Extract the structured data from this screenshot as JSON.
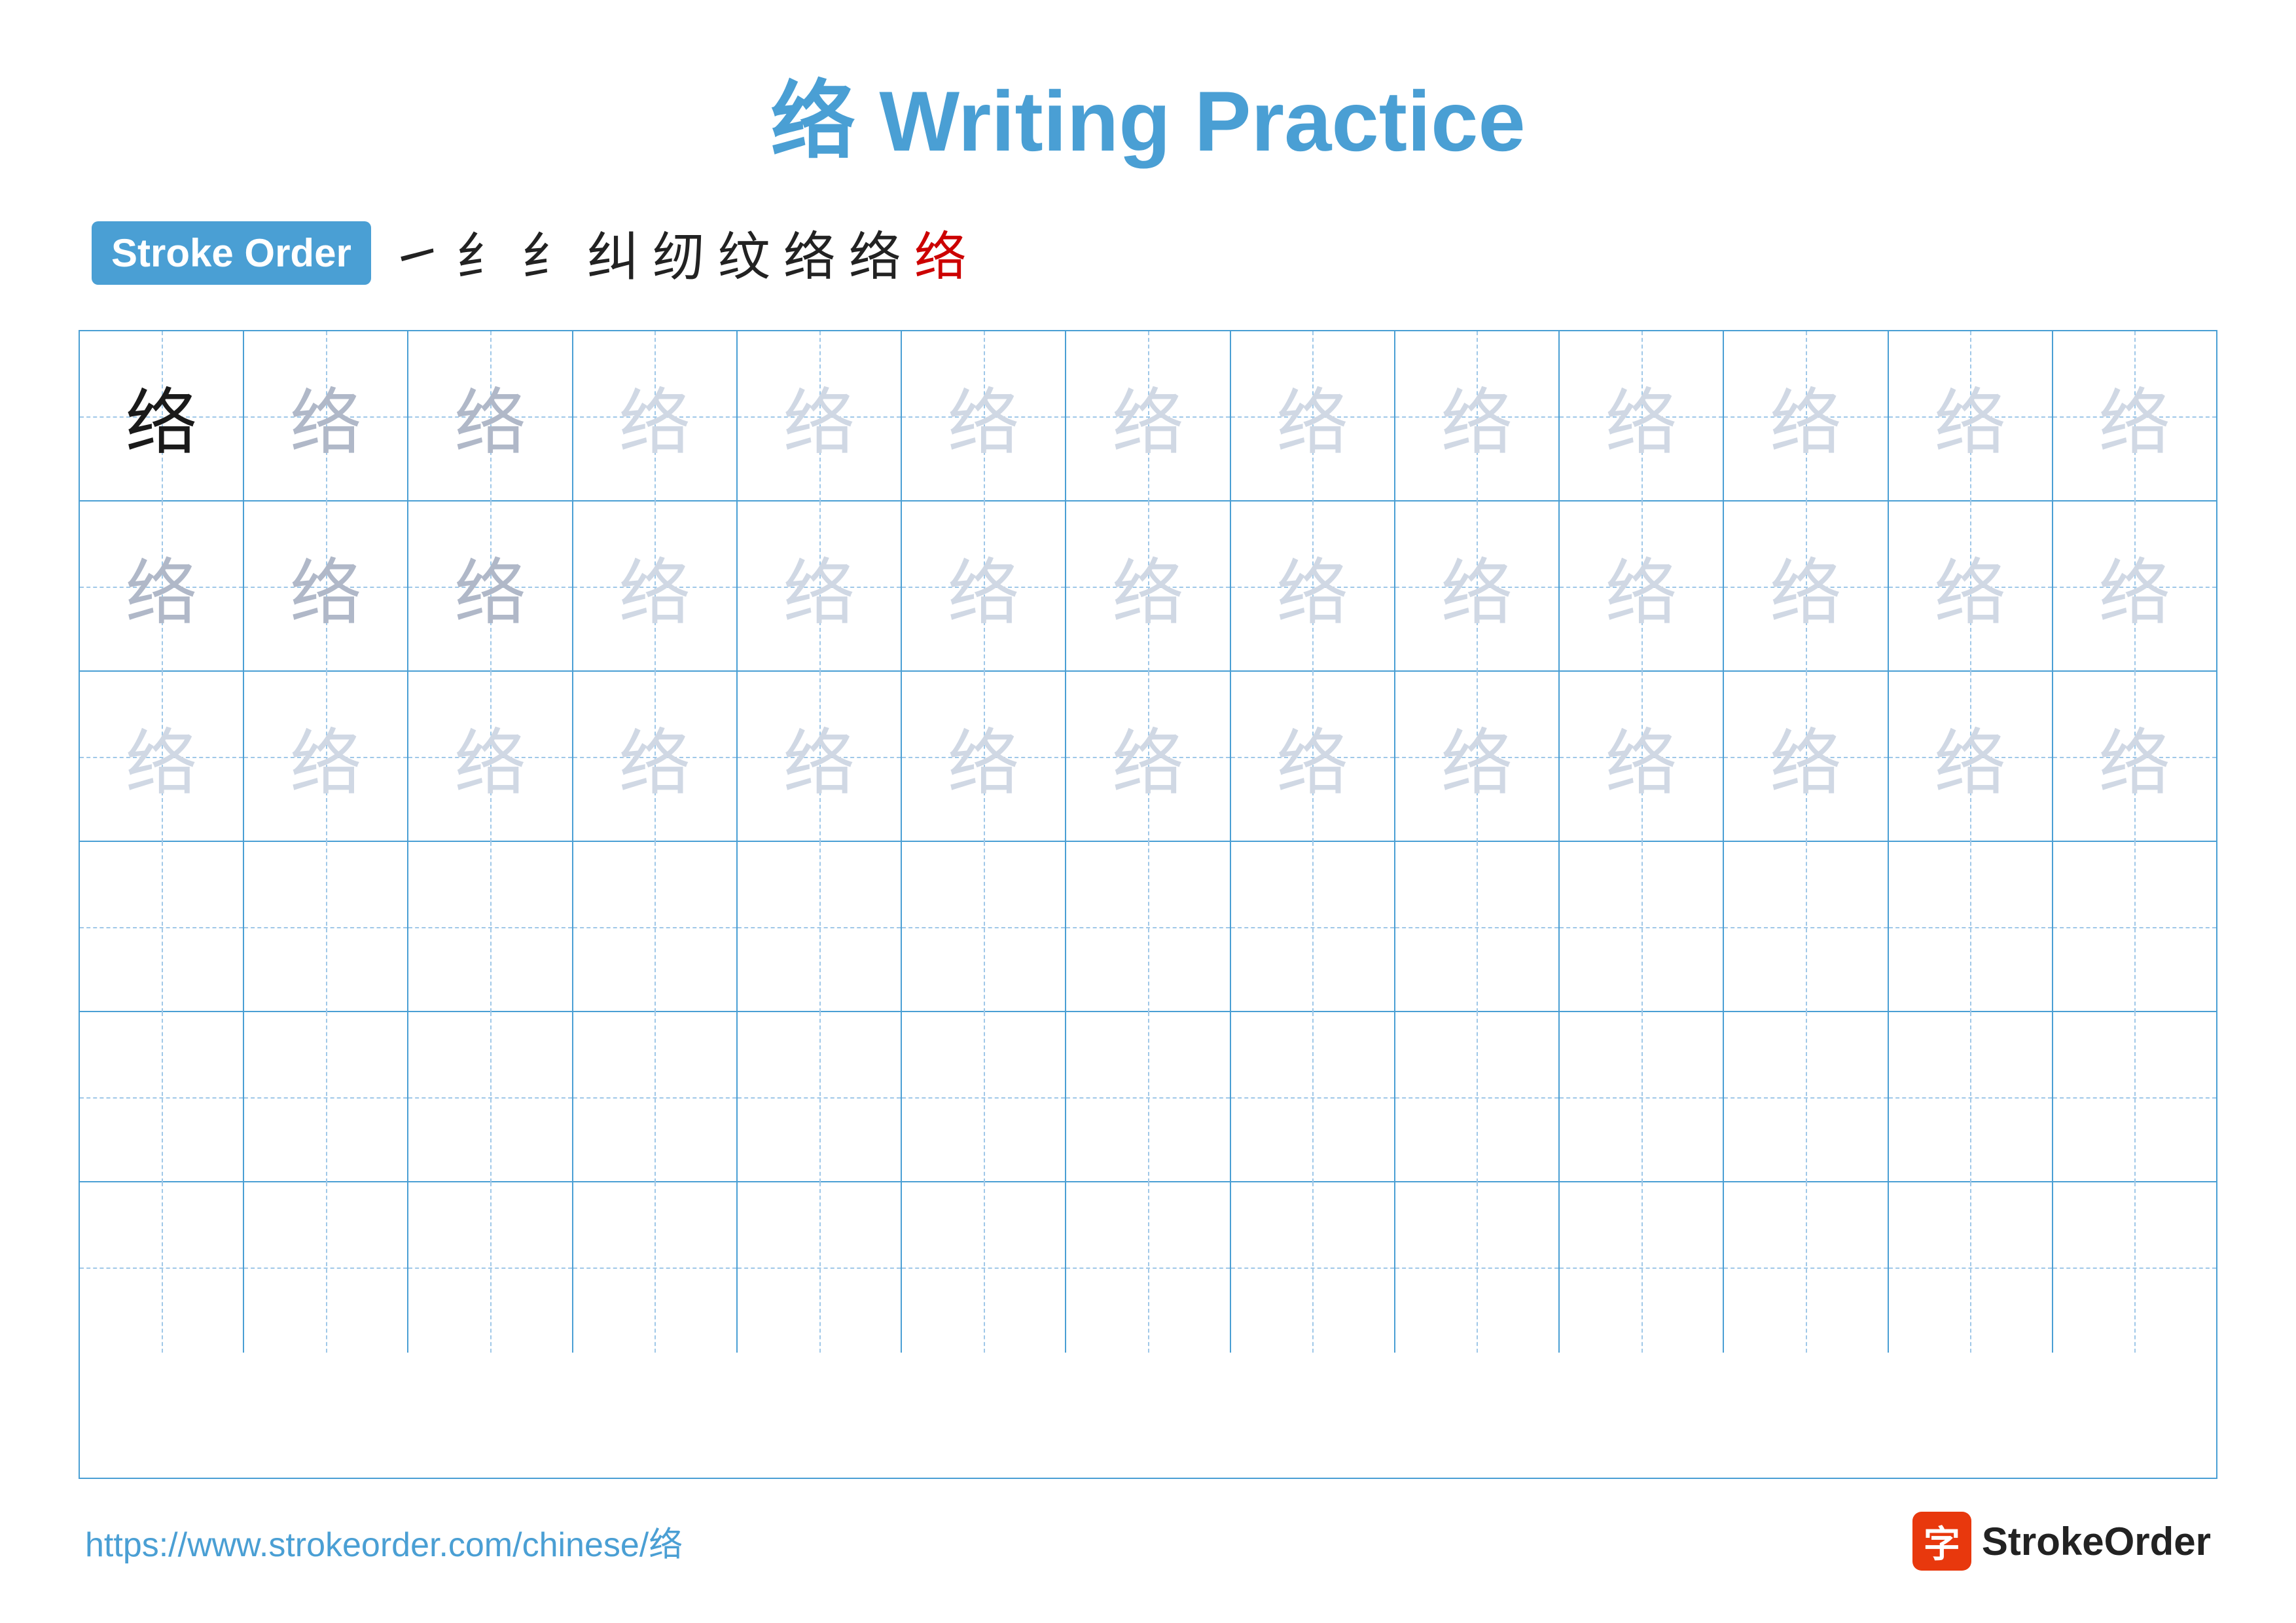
{
  "title": "络 Writing Practice",
  "stroke_order_badge": "Stroke Order",
  "stroke_steps": [
    "㇀",
    "纟",
    "纟",
    "纠",
    "纫",
    "纹",
    "络",
    "络",
    "络"
  ],
  "stroke_steps_colors": [
    "black",
    "black",
    "black",
    "black",
    "black",
    "black",
    "black",
    "black",
    "red"
  ],
  "character": "络",
  "rows": [
    {
      "cells": [
        {
          "char": "络",
          "shade": "dark"
        },
        {
          "char": "络",
          "shade": "medium"
        },
        {
          "char": "络",
          "shade": "medium"
        },
        {
          "char": "络",
          "shade": "light"
        },
        {
          "char": "络",
          "shade": "light"
        },
        {
          "char": "络",
          "shade": "light"
        },
        {
          "char": "络",
          "shade": "light"
        },
        {
          "char": "络",
          "shade": "light"
        },
        {
          "char": "络",
          "shade": "light"
        },
        {
          "char": "络",
          "shade": "light"
        },
        {
          "char": "络",
          "shade": "light"
        },
        {
          "char": "络",
          "shade": "light"
        },
        {
          "char": "络",
          "shade": "light"
        }
      ]
    },
    {
      "cells": [
        {
          "char": "络",
          "shade": "medium"
        },
        {
          "char": "络",
          "shade": "medium"
        },
        {
          "char": "络",
          "shade": "medium"
        },
        {
          "char": "络",
          "shade": "light"
        },
        {
          "char": "络",
          "shade": "light"
        },
        {
          "char": "络",
          "shade": "light"
        },
        {
          "char": "络",
          "shade": "light"
        },
        {
          "char": "络",
          "shade": "light"
        },
        {
          "char": "络",
          "shade": "light"
        },
        {
          "char": "络",
          "shade": "light"
        },
        {
          "char": "络",
          "shade": "light"
        },
        {
          "char": "络",
          "shade": "light"
        },
        {
          "char": "络",
          "shade": "light"
        }
      ]
    },
    {
      "cells": [
        {
          "char": "络",
          "shade": "light"
        },
        {
          "char": "络",
          "shade": "light"
        },
        {
          "char": "络",
          "shade": "light"
        },
        {
          "char": "络",
          "shade": "light"
        },
        {
          "char": "络",
          "shade": "light"
        },
        {
          "char": "络",
          "shade": "light"
        },
        {
          "char": "络",
          "shade": "light"
        },
        {
          "char": "络",
          "shade": "light"
        },
        {
          "char": "络",
          "shade": "light"
        },
        {
          "char": "络",
          "shade": "light"
        },
        {
          "char": "络",
          "shade": "light"
        },
        {
          "char": "络",
          "shade": "light"
        },
        {
          "char": "络",
          "shade": "light"
        }
      ]
    },
    {
      "cells": [
        {
          "char": "",
          "shade": "empty"
        },
        {
          "char": "",
          "shade": "empty"
        },
        {
          "char": "",
          "shade": "empty"
        },
        {
          "char": "",
          "shade": "empty"
        },
        {
          "char": "",
          "shade": "empty"
        },
        {
          "char": "",
          "shade": "empty"
        },
        {
          "char": "",
          "shade": "empty"
        },
        {
          "char": "",
          "shade": "empty"
        },
        {
          "char": "",
          "shade": "empty"
        },
        {
          "char": "",
          "shade": "empty"
        },
        {
          "char": "",
          "shade": "empty"
        },
        {
          "char": "",
          "shade": "empty"
        },
        {
          "char": "",
          "shade": "empty"
        }
      ]
    },
    {
      "cells": [
        {
          "char": "",
          "shade": "empty"
        },
        {
          "char": "",
          "shade": "empty"
        },
        {
          "char": "",
          "shade": "empty"
        },
        {
          "char": "",
          "shade": "empty"
        },
        {
          "char": "",
          "shade": "empty"
        },
        {
          "char": "",
          "shade": "empty"
        },
        {
          "char": "",
          "shade": "empty"
        },
        {
          "char": "",
          "shade": "empty"
        },
        {
          "char": "",
          "shade": "empty"
        },
        {
          "char": "",
          "shade": "empty"
        },
        {
          "char": "",
          "shade": "empty"
        },
        {
          "char": "",
          "shade": "empty"
        },
        {
          "char": "",
          "shade": "empty"
        }
      ]
    },
    {
      "cells": [
        {
          "char": "",
          "shade": "empty"
        },
        {
          "char": "",
          "shade": "empty"
        },
        {
          "char": "",
          "shade": "empty"
        },
        {
          "char": "",
          "shade": "empty"
        },
        {
          "char": "",
          "shade": "empty"
        },
        {
          "char": "",
          "shade": "empty"
        },
        {
          "char": "",
          "shade": "empty"
        },
        {
          "char": "",
          "shade": "empty"
        },
        {
          "char": "",
          "shade": "empty"
        },
        {
          "char": "",
          "shade": "empty"
        },
        {
          "char": "",
          "shade": "empty"
        },
        {
          "char": "",
          "shade": "empty"
        },
        {
          "char": "",
          "shade": "empty"
        }
      ]
    }
  ],
  "footer": {
    "url": "https://www.strokeorder.com/chinese/络",
    "logo_text": "StrokeOrder",
    "logo_icon": "字"
  }
}
